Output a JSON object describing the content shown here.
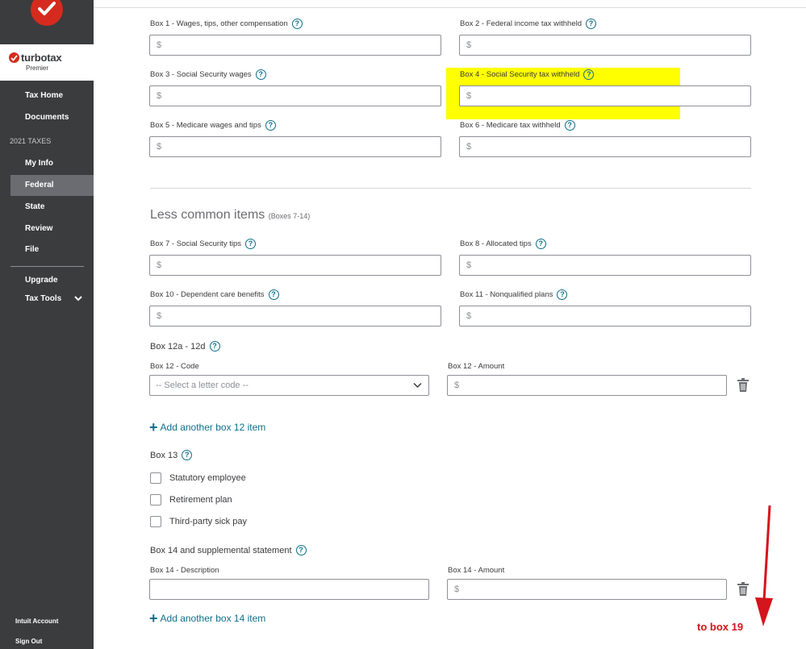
{
  "sidebar": {
    "brand": {
      "name": "turbotax",
      "edition": "Premier"
    },
    "nav_top": [
      {
        "label": "Tax Home"
      },
      {
        "label": "Documents"
      }
    ],
    "section_heading": "2021 TAXES",
    "nav_taxes": [
      {
        "label": "My Info"
      },
      {
        "label": "Federal",
        "active": true
      },
      {
        "label": "State"
      },
      {
        "label": "Review"
      },
      {
        "label": "File"
      }
    ],
    "nav_bottom": [
      {
        "label": "Upgrade"
      },
      {
        "label": "Tax Tools"
      }
    ],
    "footer": [
      {
        "label": "Intuit Account"
      },
      {
        "label": "Sign Out"
      }
    ]
  },
  "form": {
    "common_fields": [
      {
        "label": "Box 1 - Wages, tips, other compensation",
        "placeholder": "$"
      },
      {
        "label": "Box 2 - Federal income tax withheld",
        "placeholder": "$"
      },
      {
        "label": "Box 3 - Social Security wages",
        "placeholder": "$"
      },
      {
        "label": "Box 4 - Social Security tax withheld",
        "placeholder": "$"
      },
      {
        "label": "Box 5 - Medicare wages and tips",
        "placeholder": "$"
      },
      {
        "label": "Box 6 - Medicare tax withheld",
        "placeholder": "$"
      }
    ],
    "less_common": {
      "title": "Less common items",
      "subtitle": "(Boxes 7-14)",
      "fields": [
        {
          "label": "Box 7 - Social Security tips",
          "placeholder": "$"
        },
        {
          "label": "Box 8 - Allocated tips",
          "placeholder": "$"
        },
        {
          "label": "Box 10 - Dependent care benefits",
          "placeholder": "$"
        },
        {
          "label": "Box 11 - Nonqualified plans",
          "placeholder": "$"
        }
      ]
    },
    "box12": {
      "group_label": "Box 12a - 12d",
      "code_label": "Box 12 - Code",
      "code_value": "-- Select a letter code --",
      "amount_label": "Box 12 - Amount",
      "amount_placeholder": "$",
      "add_label": "Add another box 12 item"
    },
    "box13": {
      "group_label": "Box 13",
      "options": [
        {
          "label": "Statutory employee",
          "checked": false
        },
        {
          "label": "Retirement plan",
          "checked": false
        },
        {
          "label": "Third-party sick pay",
          "checked": false
        }
      ]
    },
    "box14": {
      "group_label": "Box 14 and supplemental statement",
      "desc_label": "Box 14 - Description",
      "desc_value": "",
      "amount_label": "Box 14 - Amount",
      "amount_placeholder": "$",
      "add_label": "Add another box 14 item"
    }
  },
  "annotation": {
    "text": "to box 19",
    "highlight_color": "#ffff00",
    "arrow_color": "#d4141c"
  },
  "colors": {
    "sidebar_bg": "#3b3c3e",
    "accent_link": "#0d6f8a",
    "brand_red": "#d52b1e"
  }
}
